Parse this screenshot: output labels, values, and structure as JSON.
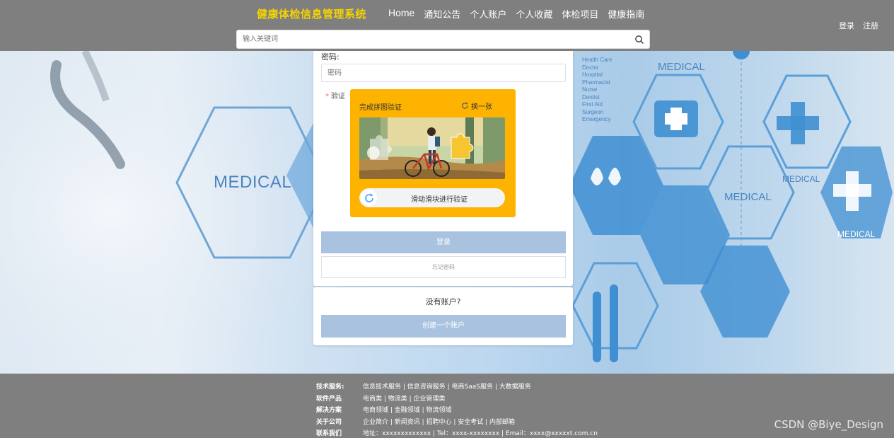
{
  "header": {
    "brand": "健康体检信息管理系统",
    "nav": [
      "Home",
      "通知公告",
      "个人账户",
      "个人收藏",
      "体检项目",
      "健康指南"
    ],
    "search_placeholder": "输入关键词",
    "login": "登录",
    "register": "注册",
    "accent": "#f5d300"
  },
  "hero": {
    "medical": "MEDICAL",
    "list": [
      "Health Care",
      "Doctor",
      "Hospital",
      "Pharmacist",
      "Nurse",
      "Dentist",
      "First Aid",
      "Surgeon",
      "Emergency"
    ]
  },
  "form": {
    "password_label": "密码:",
    "password_placeholder": "密码",
    "verify_label": "验证",
    "captcha_title": "完成拼图验证",
    "captcha_refresh": "换一张",
    "slider_text": "滑动滑块进行验证",
    "login_button": "登录",
    "forgot_button": "忘记密码",
    "no_account": "没有账户?",
    "create_button": "创建一个账户",
    "captcha_bg": "#fdb300",
    "button_color": "#a9c2e0"
  },
  "footer": {
    "rows": [
      {
        "k": "技术服务:",
        "v": "信息技术服务 | 信息咨询服务 | 电商SaaS服务 | 大数据服务"
      },
      {
        "k": "软件产品",
        "v": "电商类 | 物流类 | 企业管理类"
      },
      {
        "k": "解决方案",
        "v": "电商领域 | 金融领域 | 物流领域"
      },
      {
        "k": "关于公司",
        "v": "企业简介 | 新闻资讯 | 招聘中心 | 安全考试 | 内部邮箱"
      },
      {
        "k": "联系我们",
        "v": "地址：xxxxxxxxxxxxx | Tel：xxxx-xxxxxxxx | Email：xxxx@xxxxxt.com.cn"
      }
    ]
  },
  "watermark": "CSDN @Biye_Design"
}
